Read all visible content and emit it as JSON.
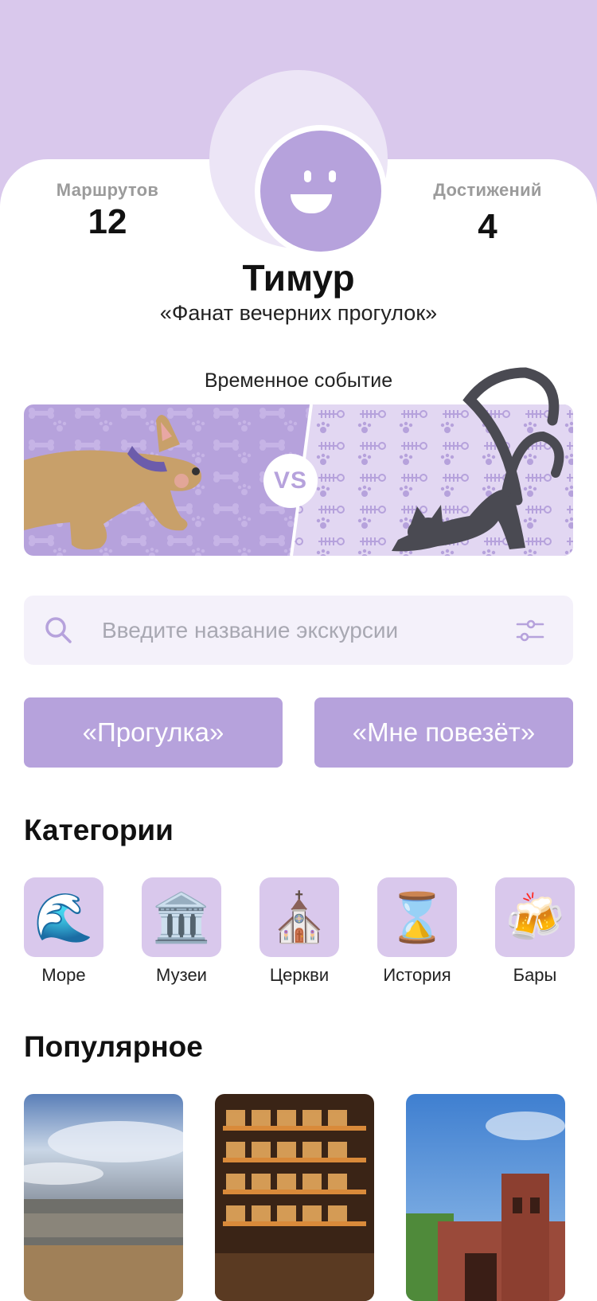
{
  "profile": {
    "name": "Тимур",
    "title": "«Фанат вечерних прогулок»",
    "stats": {
      "routes_label": "Маршрутов",
      "routes_value": "12",
      "achievements_label": "Достижений",
      "achievements_value": "4"
    }
  },
  "event": {
    "title": "Временное событие",
    "vs_label": "VS"
  },
  "search": {
    "placeholder": "Введите название экскурсии",
    "value": ""
  },
  "actions": {
    "walk_label": "«Прогулка»",
    "lucky_label": "«Мне повезёт»"
  },
  "categories": {
    "heading": "Категории",
    "items": [
      {
        "label": "Море",
        "emoji": "🌊",
        "icon": "wave-icon"
      },
      {
        "label": "Музеи",
        "emoji": "🏛️",
        "icon": "museum-icon"
      },
      {
        "label": "Церкви",
        "emoji": "⛪",
        "icon": "church-icon"
      },
      {
        "label": "История",
        "emoji": "⌛",
        "icon": "hourglass-icon"
      },
      {
        "label": "Бары",
        "emoji": "🍻",
        "icon": "beer-icon"
      }
    ]
  },
  "popular": {
    "heading": "Популярное",
    "items": [
      {
        "image": "sea-photo"
      },
      {
        "image": "bar-photo"
      },
      {
        "image": "fort-photo"
      }
    ]
  },
  "colors": {
    "accent": "#b6a2dc",
    "accent_light": "#d9c8ec",
    "search_bg": "#f4f1fa"
  }
}
